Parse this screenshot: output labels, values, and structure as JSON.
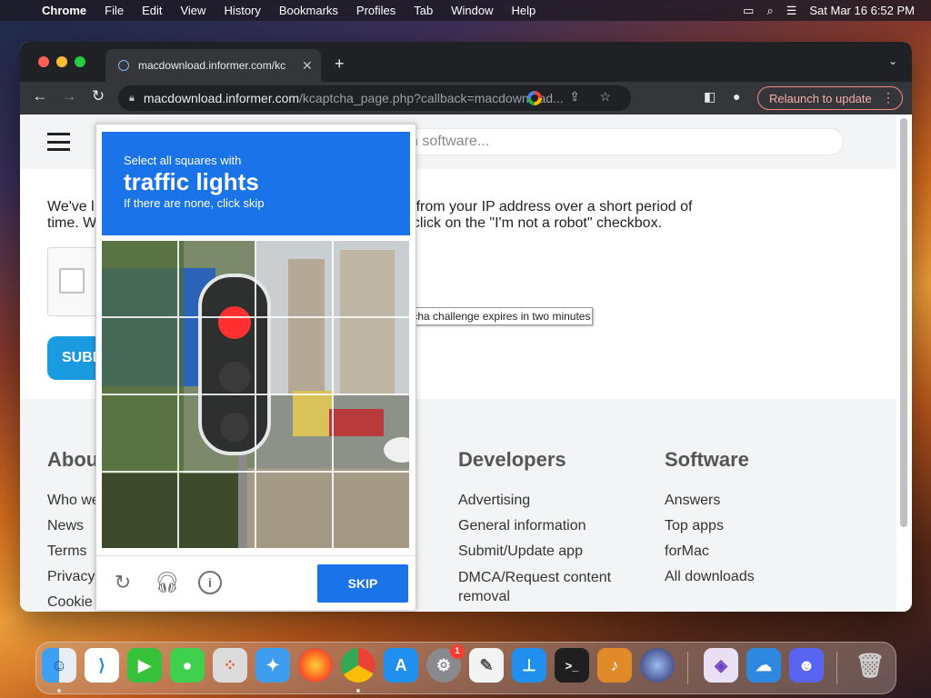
{
  "menubar": {
    "items": [
      "Chrome",
      "File",
      "Edit",
      "View",
      "History",
      "Bookmarks",
      "Profiles",
      "Tab",
      "Window",
      "Help"
    ],
    "datetime": "Sat Mar 16  6:52 PM"
  },
  "browser": {
    "tab_title": "macdownload.informer.com/kc",
    "url_host": "macdownload.informer.com",
    "url_path": "/kcaptcha_page.php?callback=macdownload...",
    "relaunch_label": "Relaunch to update"
  },
  "site": {
    "search_placeholder": "h software...",
    "intro_line1": "We've l                                        amount of requests sent from your IP address over a short period of",
    "intro_line2": "time. W                                       g those requests please click on the \"I'm not a robot\" checkbox.",
    "submit_label": "SUBI",
    "footer": {
      "about": {
        "title": "Abou",
        "links": [
          "Who we",
          "News",
          "Terms",
          "Privacy",
          "Cookie"
        ]
      },
      "developers": {
        "title": "Developers",
        "links": [
          "Advertising",
          "General information",
          "Submit/Update app",
          "DMCA/Request content removal"
        ]
      },
      "software": {
        "title": "Software",
        "links": [
          "Answers",
          "Top apps",
          "forMac",
          "All downloads"
        ]
      }
    }
  },
  "captcha": {
    "instruction_line1": "Select all squares with",
    "target": "traffic lights",
    "instruction_line3": "If there are none, click skip",
    "skip_label": "SKIP",
    "tooltip": "recaptcha challenge expires in two minutes",
    "grid_size": 4
  },
  "dock": {
    "apps": [
      "Finder",
      "VS Code",
      "FaceTime",
      "Messages",
      "Launchpad",
      "Safari",
      "Firefox",
      "Chrome",
      "App Store",
      "System Settings",
      "TextEdit",
      "Keynote",
      "Terminal",
      "GarageBand",
      "Siri",
      "Visual Studio",
      "Weather",
      "Discord",
      "Trash"
    ],
    "settings_badge": "1"
  }
}
